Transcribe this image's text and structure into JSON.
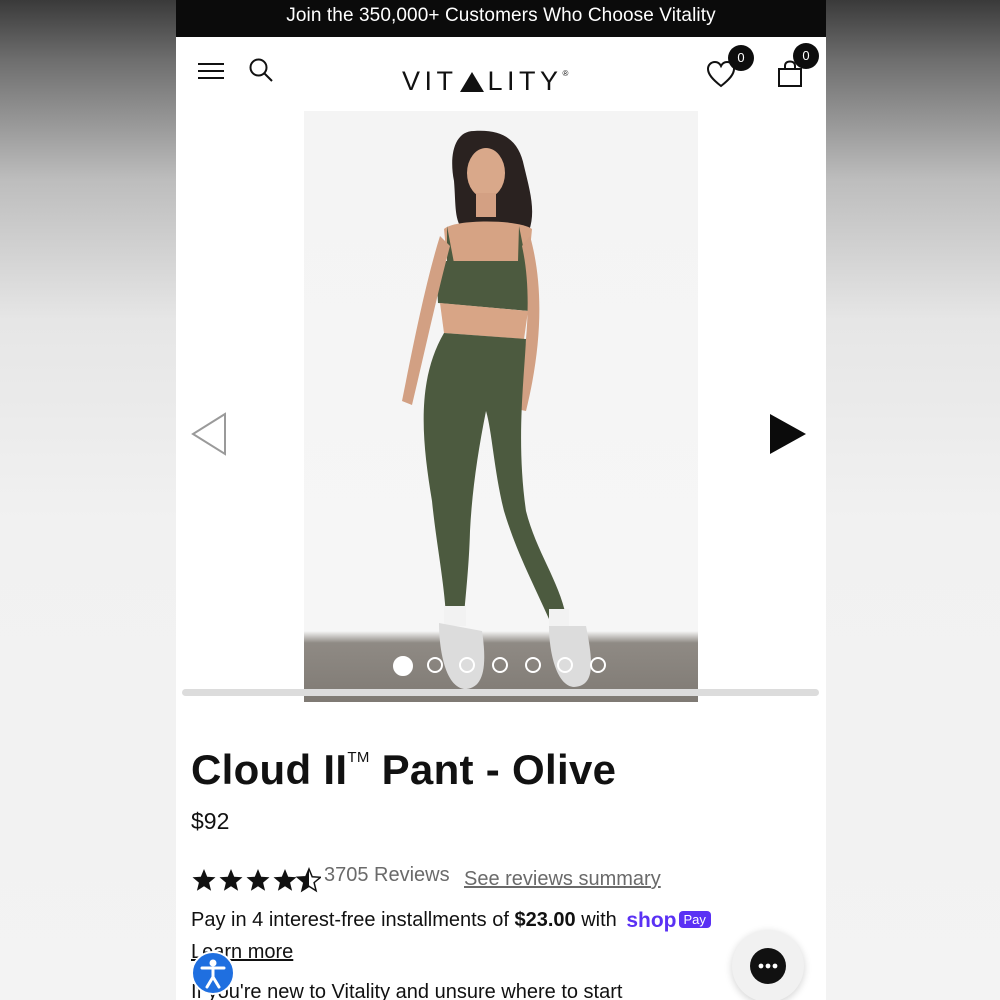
{
  "announcement": "Join the 350,000+ Customers Who Choose Vitality",
  "header": {
    "logo_left": "VIT",
    "logo_right": "LITY",
    "logo_mark": "®",
    "wishlist_count": "0",
    "cart_count": "0",
    "icons": [
      "menu-icon",
      "search-icon",
      "heart-icon",
      "bag-icon"
    ]
  },
  "gallery": {
    "total_images": 7,
    "active_index": 0,
    "arrows": [
      "chevron-left-icon",
      "play-right-icon"
    ]
  },
  "product": {
    "title_main": "Cloud II",
    "title_tm": "TM",
    "title_rest": " Pant - Olive",
    "price": "$92",
    "rating": 4.5,
    "reviews_count_label": "3705 Reviews",
    "reviews_summary_link": "See reviews summary",
    "installments_prefix": "Pay in 4 interest-free installments of ",
    "installments_amount": "$23.00",
    "installments_suffix": " with",
    "shop_logo": "shop",
    "shop_pay": "Pay",
    "learn_more": "Learn more",
    "intro_text": "If you're new to Vitality and unsure where to start"
  },
  "colors": {
    "announcement_bg": "#0b0b0b",
    "shop_pay_purple": "#5a31f4",
    "accessibility_blue": "#1f6fe0",
    "olive": "#4c5a3f"
  }
}
